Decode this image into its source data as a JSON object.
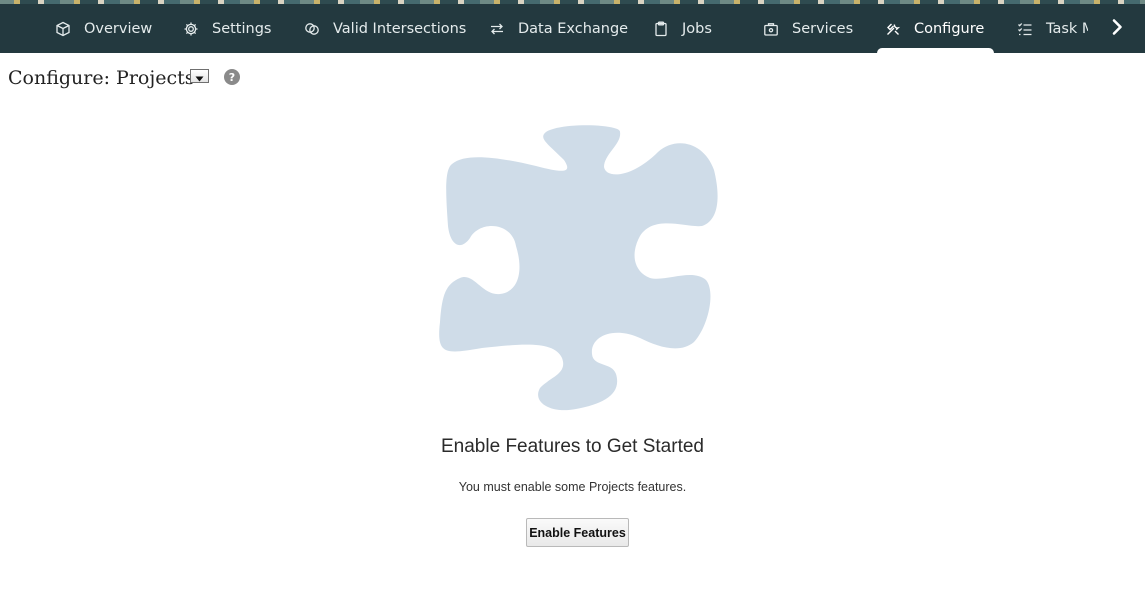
{
  "nav": {
    "tabs": [
      {
        "label": "Overview",
        "icon": "cube-icon"
      },
      {
        "label": "Settings",
        "icon": "gear-icon"
      },
      {
        "label": "Valid Intersections",
        "icon": "intersection-icon"
      },
      {
        "label": "Data Exchange",
        "icon": "exchange-arrows-icon"
      },
      {
        "label": "Jobs",
        "icon": "clipboard-icon"
      },
      {
        "label": "Services",
        "icon": "briefcase-icon"
      },
      {
        "label": "Configure",
        "icon": "tools-icon",
        "active": true
      },
      {
        "label": "Task M",
        "icon": "task-list-icon"
      }
    ],
    "next_icon": "chevron-right-icon"
  },
  "page": {
    "title": "Configure: Projects",
    "help_glyph": "?"
  },
  "empty_state": {
    "illustration": "puzzle-piece",
    "heading": "Enable Features to Get Started",
    "message": "You must enable some Projects features.",
    "button_label": "Enable Features"
  },
  "colors": {
    "navbar": "#23393f",
    "puzzle_fill": "#cfdce8",
    "nav_text": "#e4ebec"
  }
}
